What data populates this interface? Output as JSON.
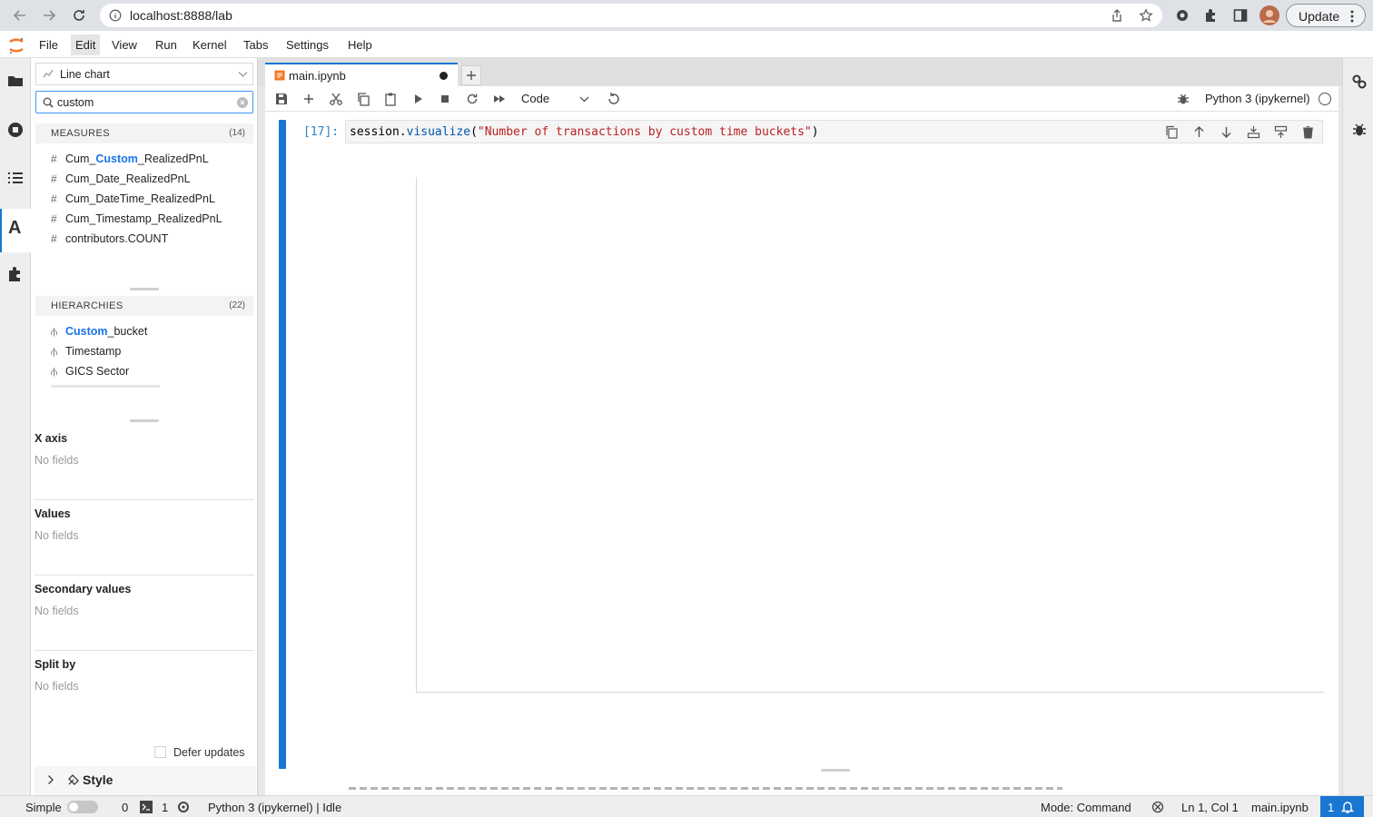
{
  "browser": {
    "url": "localhost:8888/lab",
    "update_label": "Update"
  },
  "menu": [
    "File",
    "Edit",
    "View",
    "Run",
    "Kernel",
    "Tabs",
    "Settings",
    "Help"
  ],
  "left_panel": {
    "chart_type": "Line chart",
    "search_value": "custom",
    "measures": {
      "title": "MEASURES",
      "count": "(14)",
      "items": [
        {
          "pre": "Cum_",
          "match": "Custom",
          "post": "_RealizedPnL"
        },
        {
          "pre": "Cum_Date_RealizedPnL",
          "match": "",
          "post": ""
        },
        {
          "pre": "Cum_DateTime_RealizedPnL",
          "match": "",
          "post": ""
        },
        {
          "pre": "Cum_Timestamp_RealizedPnL",
          "match": "",
          "post": ""
        },
        {
          "pre": "contributors.COUNT",
          "match": "",
          "post": ""
        }
      ]
    },
    "hierarchies": {
      "title": "HIERARCHIES",
      "count": "(22)",
      "items": [
        {
          "pre": "",
          "match": "Custom",
          "post": "_bucket"
        },
        {
          "pre": "Timestamp",
          "match": "",
          "post": ""
        },
        {
          "pre": "GICS Sector",
          "match": "",
          "post": ""
        }
      ]
    },
    "wells": [
      {
        "title": "X axis",
        "empty": "No fields"
      },
      {
        "title": "Values",
        "empty": "No fields"
      },
      {
        "title": "Secondary values",
        "empty": "No fields"
      },
      {
        "title": "Split by",
        "empty": "No fields"
      }
    ],
    "defer_label": "Defer updates",
    "style_label": "Style"
  },
  "notebook": {
    "tab_title": "main.ipynb",
    "cell_type": "Code",
    "kernel_name": "Python 3 (ipykernel)",
    "prompt": "[17]:",
    "code": {
      "obj": "session.",
      "method": "visualize",
      "open": "(",
      "string": "\"Number of transactions by custom time buckets\"",
      "close": ")"
    }
  },
  "status": {
    "mode_label": "Simple",
    "terminals": "0",
    "kernels": "1",
    "kernel_status": "Python 3 (ipykernel) | Idle",
    "mode": "Mode: Command",
    "position": "Ln 1, Col 1",
    "filename": "main.ipynb",
    "notifications": "1"
  },
  "colors": {
    "accent": "#1976d2",
    "match_highlight": "#1a73e8",
    "code_string": "#ba2121",
    "code_method": "#0055aa"
  }
}
